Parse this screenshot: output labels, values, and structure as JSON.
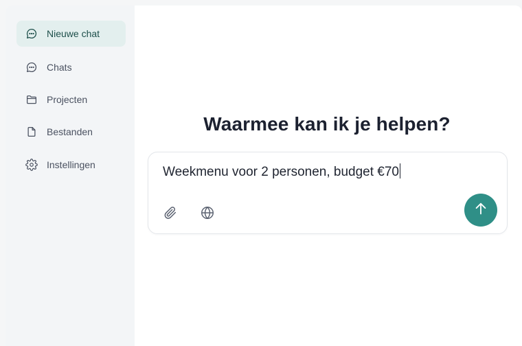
{
  "sidebar": {
    "items": [
      {
        "label": "Nieuwe chat",
        "icon": "chat-bubble-icon",
        "active": true
      },
      {
        "label": "Chats",
        "icon": "chat-bubble-icon",
        "active": false
      },
      {
        "label": "Projecten",
        "icon": "folder-icon",
        "active": false
      },
      {
        "label": "Bestanden",
        "icon": "file-icon",
        "active": false
      },
      {
        "label": "Instellingen",
        "icon": "gear-icon",
        "active": false
      }
    ]
  },
  "main": {
    "headline": "Waarmee kan ik je helpen?",
    "composer": {
      "value": "Weekmenu voor 2 personen, budget €70",
      "attach_icon": "paperclip-icon",
      "web_icon": "globe-icon",
      "send_icon": "arrow-up-icon"
    }
  },
  "colors": {
    "accent": "#2f8f87",
    "active_bg": "#e3efee",
    "sidebar_bg": "#f3f5f7"
  }
}
